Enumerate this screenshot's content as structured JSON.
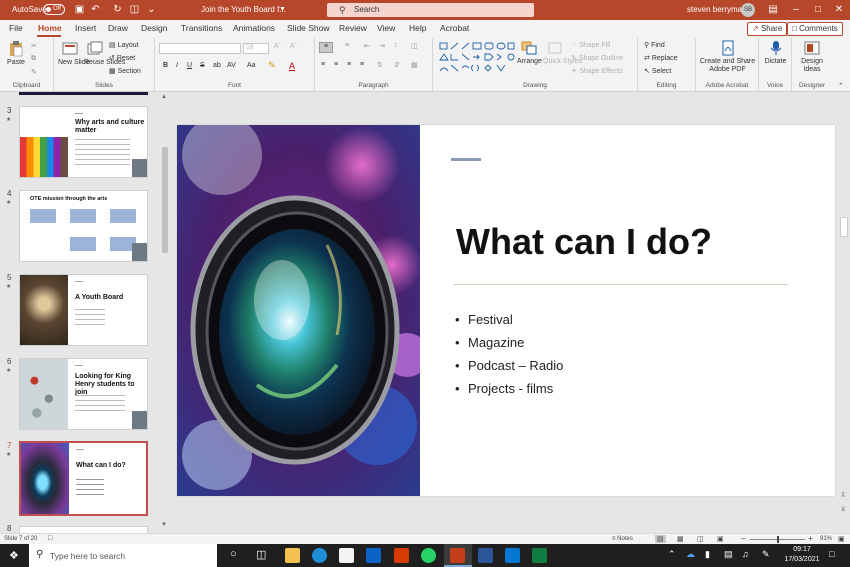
{
  "titlebar": {
    "autosave": "AutoSave",
    "autosave_state": "Off",
    "doc_title": "Join the Youth Board f...",
    "search_placeholder": "Search",
    "user_name": "steven berryman",
    "user_initials": "SB"
  },
  "tabs": [
    "File",
    "Home",
    "Insert",
    "Draw",
    "Design",
    "Transitions",
    "Animations",
    "Slide Show",
    "Review",
    "View",
    "Help",
    "Acrobat"
  ],
  "share_label": "Share",
  "comments_label": "Comments",
  "ribbon": {
    "paste": "Paste",
    "clipboard": "Clipboard",
    "new_slide": "New Slide",
    "reuse_slides": "Reuse Slides",
    "layout": "Layout",
    "reset": "Reset",
    "section": "Section",
    "slides": "Slides",
    "font_size": "18",
    "font": "Font",
    "paragraph": "Paragraph",
    "arrange": "Arrange",
    "quick_styles": "Quick Styles",
    "shape_fill": "Shape Fill",
    "shape_outline": "Shape Outline",
    "shape_effects": "Shape Effects",
    "drawing": "Drawing",
    "find": "Find",
    "replace": "Replace",
    "select": "Select",
    "editing": "Editing",
    "create_share_1": "Create and Share",
    "create_share_2": "Adobe PDF",
    "adobe_acrobat": "Adobe Acrobat",
    "dictate": "Dictate",
    "voice": "Voice",
    "design_ideas_1": "Design",
    "design_ideas_2": "Ideas",
    "designer": "Designer"
  },
  "thumbnails": [
    {
      "num": "3",
      "title": "Why arts and culture matter"
    },
    {
      "num": "4",
      "title": "OTE mission through the arts"
    },
    {
      "num": "5",
      "title": "A Youth Board"
    },
    {
      "num": "6",
      "title": "Looking for King Henry students to join"
    },
    {
      "num": "7",
      "title": "What can I do?"
    },
    {
      "num": "8",
      "title": ""
    }
  ],
  "slide": {
    "title": "What can I do?",
    "bullets": [
      "Festival",
      "Magazine",
      "Podcast – Radio",
      "Projects - films"
    ]
  },
  "status": {
    "slide_info": "Slide 7 of 20",
    "notes": "Notes",
    "zoom": "91%"
  },
  "taskbar": {
    "search_placeholder": "Type here to search",
    "time": "09:17",
    "date": "17/03/2021"
  },
  "colors": {
    "accent": "#b7472a",
    "selected_border": "#c0504d",
    "slide_dash": "#8e9ab5"
  }
}
